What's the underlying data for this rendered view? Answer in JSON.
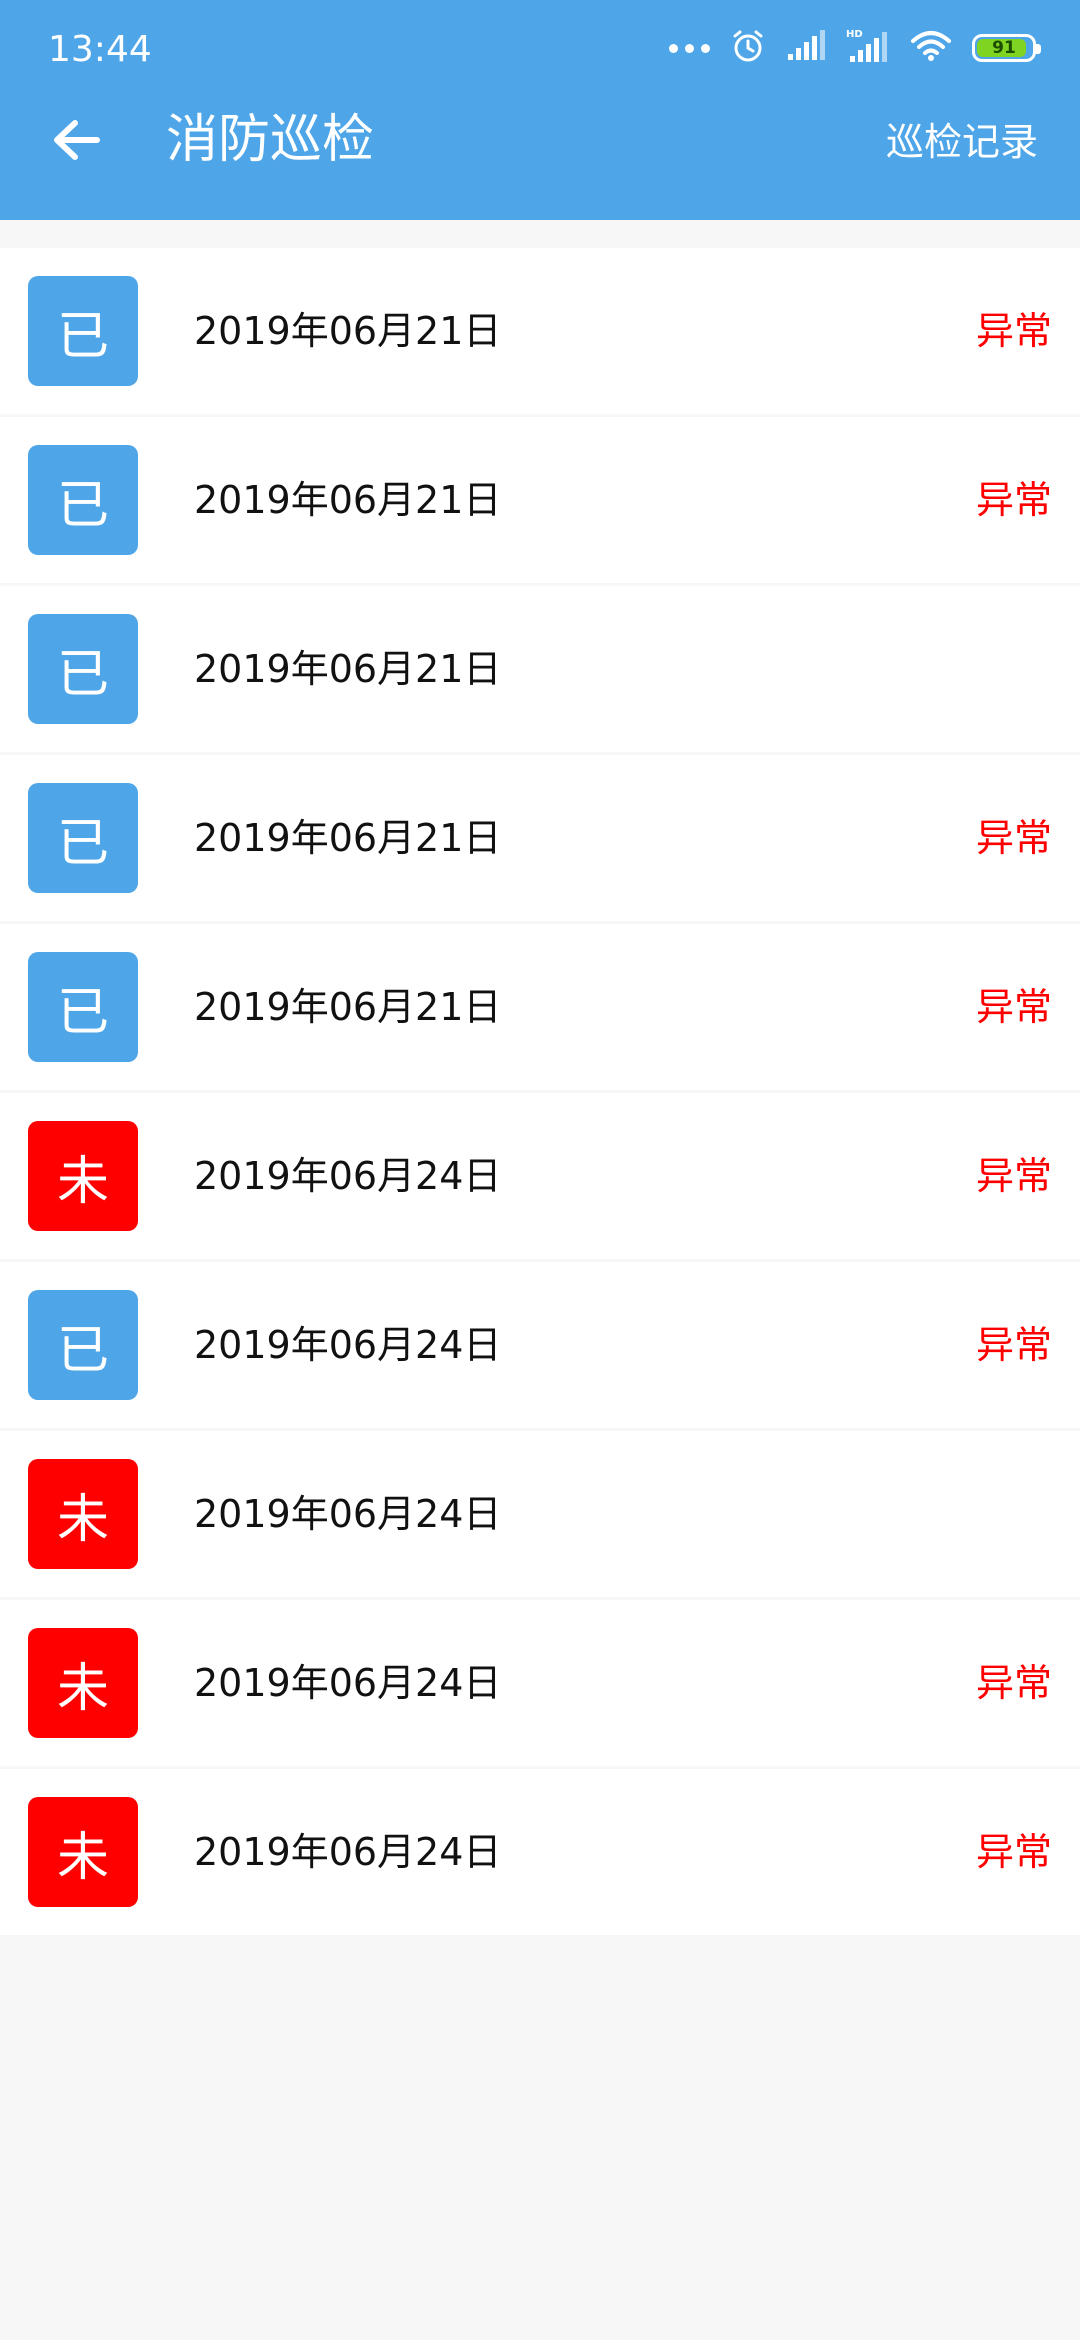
{
  "status_bar": {
    "time": "13:44",
    "battery": "91",
    "battery_fraction": 0.91,
    "icons": [
      "more-dots-icon",
      "alarm-icon",
      "signal-icon",
      "hd-signal-icon",
      "wifi-icon",
      "battery-icon"
    ]
  },
  "header": {
    "back_icon": "arrow-left-icon",
    "title": "消防巡检",
    "action_label": "巡检记录"
  },
  "colors": {
    "primary": "#4ea6e9",
    "done_badge": "#4ea6e9",
    "pending_badge": "#ff0000",
    "abnormal_text": "#ff0000"
  },
  "records": [
    {
      "badge": "已",
      "date": "2019年06月21日",
      "flag": "异常",
      "badge_color": "#4ea6e9"
    },
    {
      "badge": "已",
      "date": "2019年06月21日",
      "flag": "异常",
      "badge_color": "#4ea6e9"
    },
    {
      "badge": "已",
      "date": "2019年06月21日",
      "flag": "",
      "badge_color": "#4ea6e9"
    },
    {
      "badge": "已",
      "date": "2019年06月21日",
      "flag": "异常",
      "badge_color": "#4ea6e9"
    },
    {
      "badge": "已",
      "date": "2019年06月21日",
      "flag": "异常",
      "badge_color": "#4ea6e9"
    },
    {
      "badge": "未",
      "date": "2019年06月24日",
      "flag": "异常",
      "badge_color": "#ff0000"
    },
    {
      "badge": "已",
      "date": "2019年06月24日",
      "flag": "异常",
      "badge_color": "#4ea6e9"
    },
    {
      "badge": "未",
      "date": "2019年06月24日",
      "flag": "",
      "badge_color": "#ff0000"
    },
    {
      "badge": "未",
      "date": "2019年06月24日",
      "flag": "异常",
      "badge_color": "#ff0000"
    },
    {
      "badge": "未",
      "date": "2019年06月24日",
      "flag": "异常",
      "badge_color": "#ff0000"
    }
  ]
}
